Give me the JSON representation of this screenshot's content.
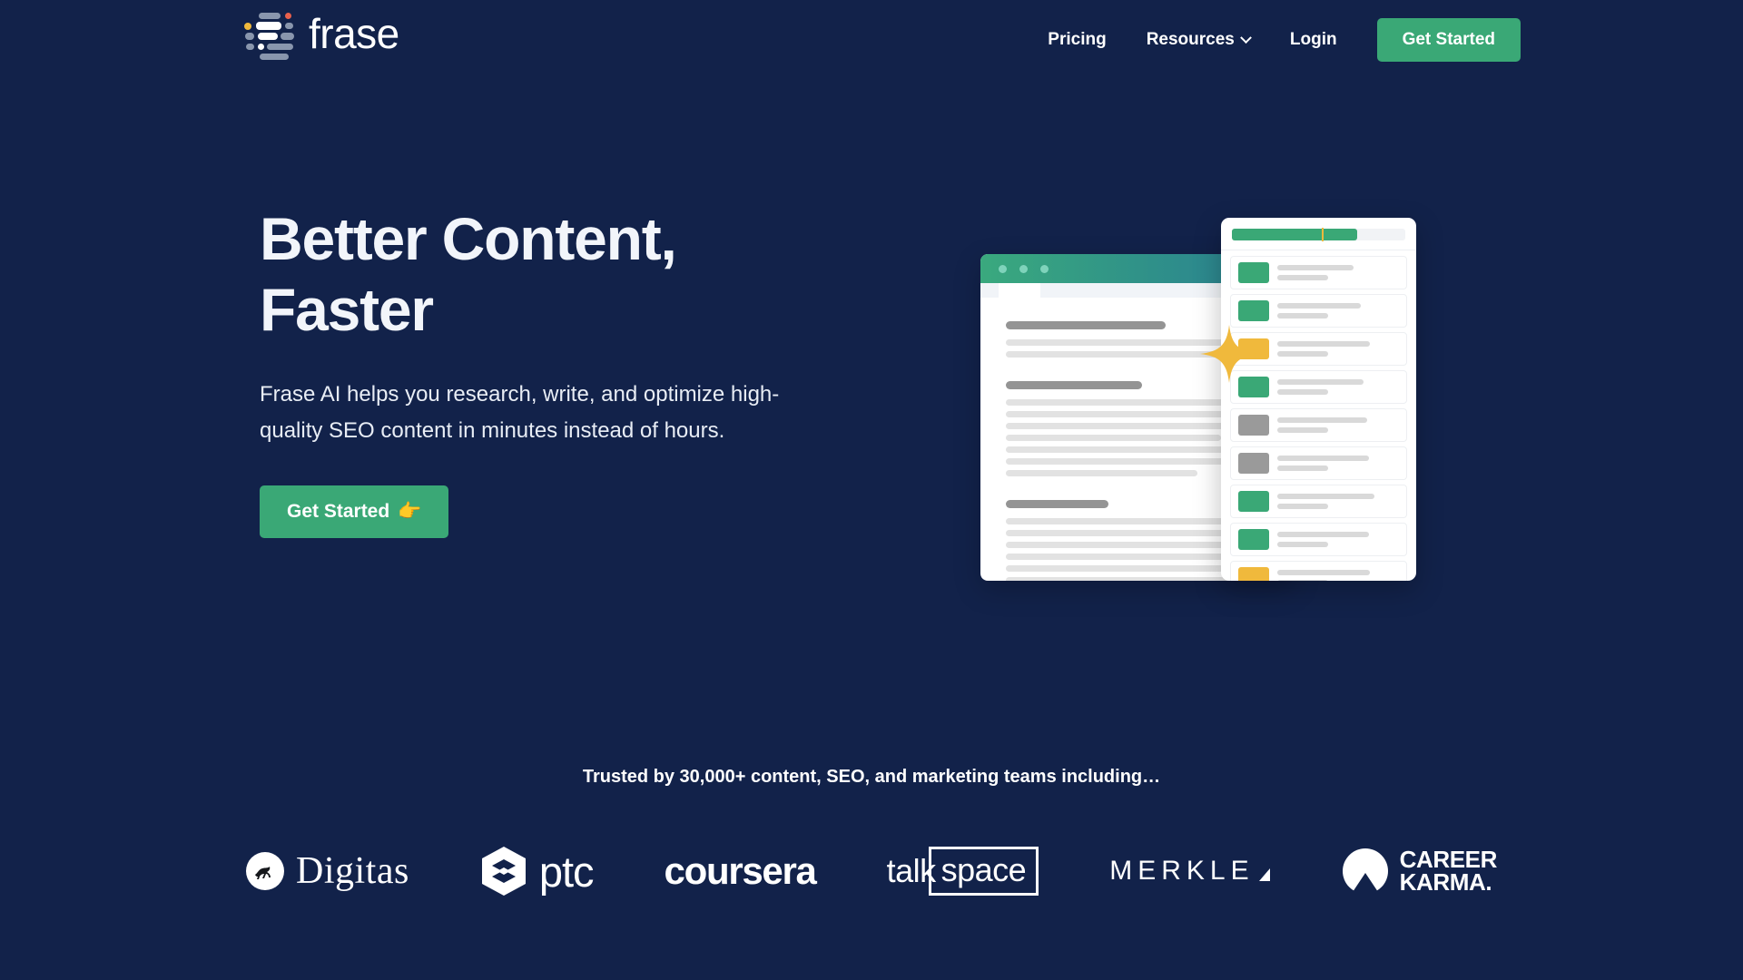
{
  "site": {
    "brand_name": "frase",
    "background_color": "#12224a",
    "accent_green": "#3aa876",
    "accent_yellow": "#f0b93c",
    "accent_red": "#dd6b6b",
    "accent_gray": "#9a9a9a"
  },
  "header": {
    "nav_items": [
      {
        "label": "Pricing",
        "has_caret": false
      },
      {
        "label": "Resources",
        "has_caret": true
      },
      {
        "label": "Login",
        "has_caret": false
      }
    ],
    "cta_label": "Get Started"
  },
  "hero": {
    "headline": "Better Content,\nFaster",
    "subheadline": "Frase AI helps you research, write, and optimize high-quality SEO content in minutes instead of hours.",
    "cta_label": "Get Started",
    "cta_emoji": "👉"
  },
  "illustration": {
    "window_dots": 3,
    "progress": {
      "fill_percent": 72,
      "marker_percent": 52
    },
    "doc_blocks": [
      {
        "heading_width": "61%",
        "lines": [
          "98%",
          "84%"
        ]
      },
      {
        "heading_width": "52%",
        "lines": [
          "99%",
          "88%",
          "95%",
          "82%",
          "94%",
          "97%",
          "73%"
        ]
      },
      {
        "heading_width": "39%",
        "lines": [
          "96%",
          "85%",
          "91%",
          "93%",
          "99%",
          "90%"
        ]
      }
    ],
    "panel_rows": [
      {
        "status": "green"
      },
      {
        "status": "green"
      },
      {
        "status": "yellow"
      },
      {
        "status": "green"
      },
      {
        "status": "gray"
      },
      {
        "status": "gray"
      },
      {
        "status": "green"
      },
      {
        "status": "green"
      },
      {
        "status": "yellow"
      },
      {
        "status": "gray"
      },
      {
        "status": "red"
      },
      {
        "status": "gray"
      }
    ]
  },
  "social_proof": {
    "heading": "Trusted by 30,000+ content, SEO, and marketing teams including…",
    "logos": [
      {
        "name": "Digitas"
      },
      {
        "name": "ptc"
      },
      {
        "name": "coursera"
      },
      {
        "name": "talkspace",
        "part_one": "talk",
        "part_two": "space"
      },
      {
        "name": "MERKLE"
      },
      {
        "name": "CAREER KARMA",
        "line_one": "CAREER",
        "line_two": "KARMA."
      }
    ]
  }
}
